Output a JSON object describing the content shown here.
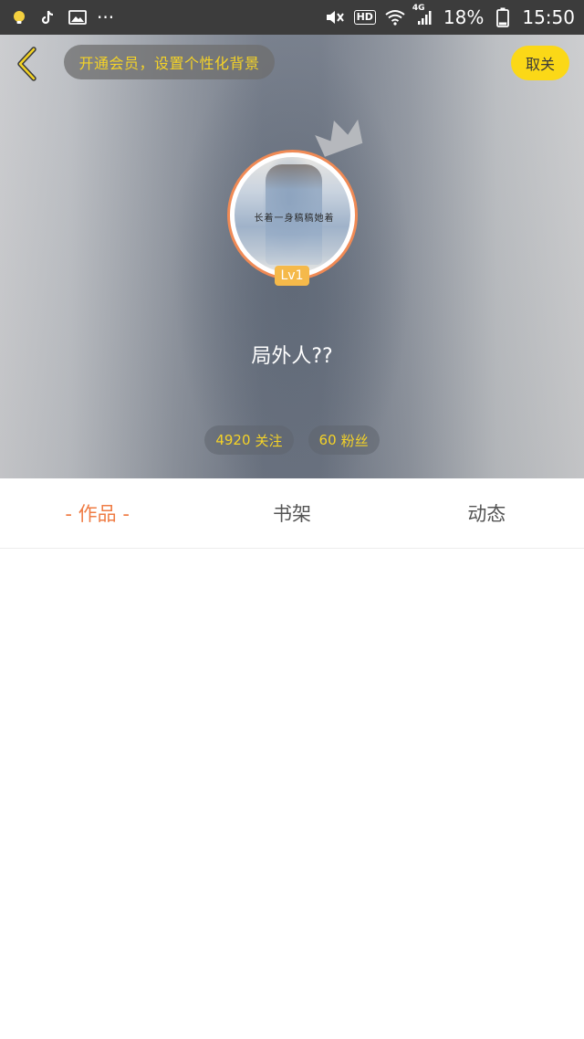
{
  "status_bar": {
    "battery_percent": "18%",
    "time": "15:50",
    "hd_label": "HD",
    "network_label": "4G",
    "more_label": "···"
  },
  "header": {
    "vip_prompt": "开通会员，设置个性化背景",
    "unfollow_label": "取关",
    "avatar_overlay_text": "长着一身稿稿她着",
    "level": "Lv1",
    "username": "局外人??",
    "following_count": "4920",
    "following_label": "关注",
    "followers_count": "60",
    "followers_label": "粉丝"
  },
  "tabs": [
    {
      "label": "- 作品 -",
      "active": true
    },
    {
      "label": "书架",
      "active": false
    },
    {
      "label": "动态",
      "active": false
    }
  ],
  "colors": {
    "accent_orange": "#ef7c44",
    "accent_yellow": "#fbd817",
    "pill_text_yellow": "#f5d327",
    "status_bar_bg": "#3c3c3c"
  },
  "icons": [
    "bulb-notification-icon",
    "tiktok-icon",
    "gallery-icon",
    "mute-icon",
    "wifi-icon",
    "signal-icon",
    "battery-icon",
    "back-chevron-icon",
    "crown-icon"
  ]
}
